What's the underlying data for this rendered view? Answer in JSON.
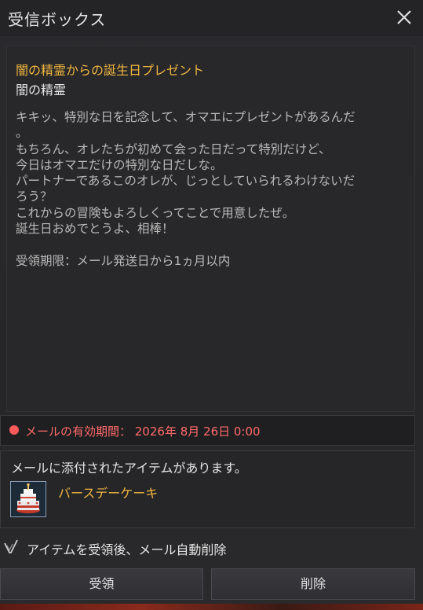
{
  "window": {
    "title": "受信ボックス"
  },
  "mail": {
    "subject": "闇の精霊からの誕生日プレゼント",
    "sender": "闇の精霊",
    "message_lines": [
      "キキッ、特別な日を記念して、オマエにプレゼントがあるんだ",
      "。",
      "もちろん、オレたちが初めて会った日だって特別だけど、",
      "今日はオマエだけの特別な日だしな。",
      "パートナーであるこのオレが、じっとしていられるわけないだ",
      "ろう？",
      "これからの冒険もよろしくってことで用意したぜ。",
      "誕生日おめでとうよ、相棒！"
    ],
    "deadline": "受領期限：メール発送日から1ヵ月以内"
  },
  "expiry": {
    "label": "メールの有効期間： 2026年 8月 26日 0:00",
    "color": "#ff6a6a"
  },
  "attachment": {
    "note": "メールに添付されたアイテムがあります。",
    "item_name": "バースデーケーキ",
    "item_icon": "birthday-cake-icon"
  },
  "auto_delete": {
    "label": "アイテムを受領後、メール自動削除",
    "checked": true
  },
  "buttons": {
    "receive": "受領",
    "delete": "削除"
  },
  "colors": {
    "accent": "#f0b640",
    "text": "#b9b9b9"
  }
}
